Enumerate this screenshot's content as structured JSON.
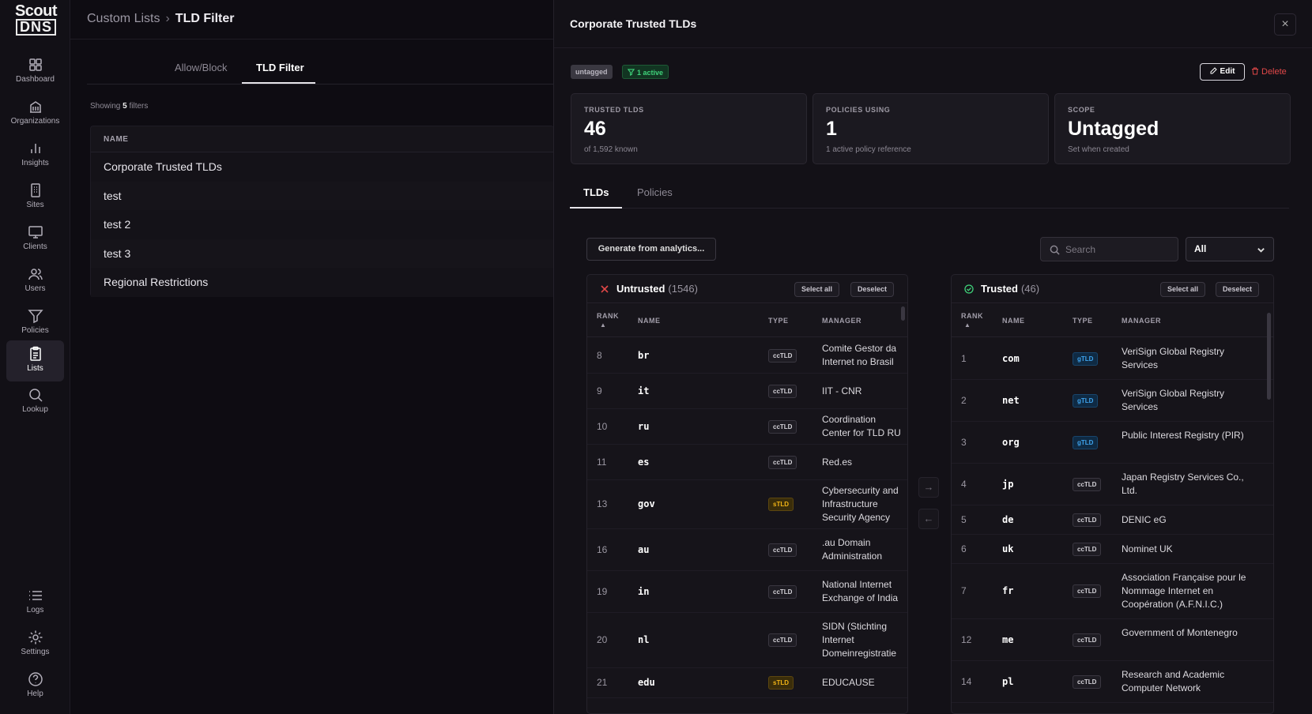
{
  "logo": {
    "line1": "Scout",
    "line2": "DNS"
  },
  "nav": [
    {
      "label": "Dashboard",
      "icon": "dashboard-icon"
    },
    {
      "label": "Organizations",
      "icon": "organizations-icon"
    },
    {
      "label": "Insights",
      "icon": "insights-icon"
    },
    {
      "label": "Sites",
      "icon": "sites-icon"
    },
    {
      "label": "Clients",
      "icon": "clients-icon"
    },
    {
      "label": "Users",
      "icon": "users-icon"
    },
    {
      "label": "Policies",
      "icon": "policies-icon"
    },
    {
      "label": "Lists",
      "icon": "lists-icon"
    },
    {
      "label": "Lookup",
      "icon": "lookup-icon"
    }
  ],
  "nav_bottom": [
    {
      "label": "Logs",
      "icon": "logs-icon"
    },
    {
      "label": "Settings",
      "icon": "settings-icon"
    },
    {
      "label": "Help",
      "icon": "help-icon"
    }
  ],
  "breadcrumb": {
    "parent": "Custom Lists",
    "separator": "›",
    "current": "TLD Filter"
  },
  "tabs": {
    "allow_block": "Allow/Block",
    "tld_filter": "TLD Filter"
  },
  "showing": {
    "prefix": "Showing",
    "count": "5",
    "suffix": "filters"
  },
  "filters": {
    "header": "NAME",
    "rows": [
      "Corporate Trusted TLDs",
      "test",
      "test 2",
      "test 3",
      "Regional Restrictions"
    ]
  },
  "drawer": {
    "title": "Corporate Trusted TLDs",
    "close": "×",
    "badge_untagged": "untagged",
    "badge_active": "1 active",
    "edit_label": "Edit",
    "delete_label": "Delete",
    "cards": [
      {
        "label": "TRUSTED TLDS",
        "value": "46",
        "sub": "of 1,592 known"
      },
      {
        "label": "POLICIES USING",
        "value": "1",
        "sub": "1 active policy reference"
      },
      {
        "label": "SCOPE",
        "value": "Untagged",
        "sub": "Set when created"
      }
    ],
    "tabs": {
      "tlds": "TLDs",
      "policies": "Policies"
    },
    "generate_label": "Generate from analytics...",
    "search_placeholder": "Search",
    "filter_value": "All",
    "move_right": "→",
    "move_left": "←",
    "colors": {
      "gtld": "#3fa4ee",
      "stld": "#f2b416",
      "cctld": "#d4d2d8",
      "danger": "#e24848",
      "success": "#3fd27a"
    }
  },
  "untrusted": {
    "title": "Untrusted",
    "count": "(1546)",
    "select_all": "Select all",
    "deselect": "Deselect",
    "headers": {
      "rank": "RANK",
      "sort": "▲",
      "name": "NAME",
      "type": "TYPE",
      "manager": "MANAGER"
    },
    "rows": [
      {
        "rank": "8",
        "name": "br",
        "type": "ccTLD",
        "manager": "Comite Gestor da Internet no Brasil"
      },
      {
        "rank": "9",
        "name": "it",
        "type": "ccTLD",
        "manager": "IIT - CNR"
      },
      {
        "rank": "10",
        "name": "ru",
        "type": "ccTLD",
        "manager": "Coordination Center for TLD RU"
      },
      {
        "rank": "11",
        "name": "es",
        "type": "ccTLD",
        "manager": "Red.es"
      },
      {
        "rank": "13",
        "name": "gov",
        "type": "sTLD",
        "manager": "Cybersecurity and Infrastructure Security Agency"
      },
      {
        "rank": "16",
        "name": "au",
        "type": "ccTLD",
        "manager": ".au Domain Administration (auDA)"
      },
      {
        "rank": "19",
        "name": "in",
        "type": "ccTLD",
        "manager": "National Internet Exchange of India"
      },
      {
        "rank": "20",
        "name": "nl",
        "type": "ccTLD",
        "manager": "SIDN (Stichting Internet Domeinregistratie Nederland)"
      },
      {
        "rank": "21",
        "name": "edu",
        "type": "sTLD",
        "manager": "EDUCAUSE"
      }
    ]
  },
  "trusted": {
    "title": "Trusted",
    "count": "(46)",
    "select_all": "Select all",
    "deselect": "Deselect",
    "headers": {
      "rank": "RANK",
      "sort": "▲",
      "name": "NAME",
      "type": "TYPE",
      "manager": "MANAGER"
    },
    "rows": [
      {
        "rank": "1",
        "name": "com",
        "type": "gTLD",
        "manager": "VeriSign Global Registry Services"
      },
      {
        "rank": "2",
        "name": "net",
        "type": "gTLD",
        "manager": "VeriSign Global Registry Services"
      },
      {
        "rank": "3",
        "name": "org",
        "type": "gTLD",
        "manager": "Public Interest Registry (PIR)"
      },
      {
        "rank": "4",
        "name": "jp",
        "type": "ccTLD",
        "manager": "Japan Registry Services Co., Ltd."
      },
      {
        "rank": "5",
        "name": "de",
        "type": "ccTLD",
        "manager": "DENIC eG"
      },
      {
        "rank": "6",
        "name": "uk",
        "type": "ccTLD",
        "manager": "Nominet UK"
      },
      {
        "rank": "7",
        "name": "fr",
        "type": "ccTLD",
        "manager": "Association Française pour le Nommage Internet en Coopération (A.F.N.I.C.)"
      },
      {
        "rank": "12",
        "name": "me",
        "type": "ccTLD",
        "manager": "Government of Montenegro"
      },
      {
        "rank": "14",
        "name": "pl",
        "type": "ccTLD",
        "manager": "Research and Academic Computer Network"
      }
    ]
  }
}
